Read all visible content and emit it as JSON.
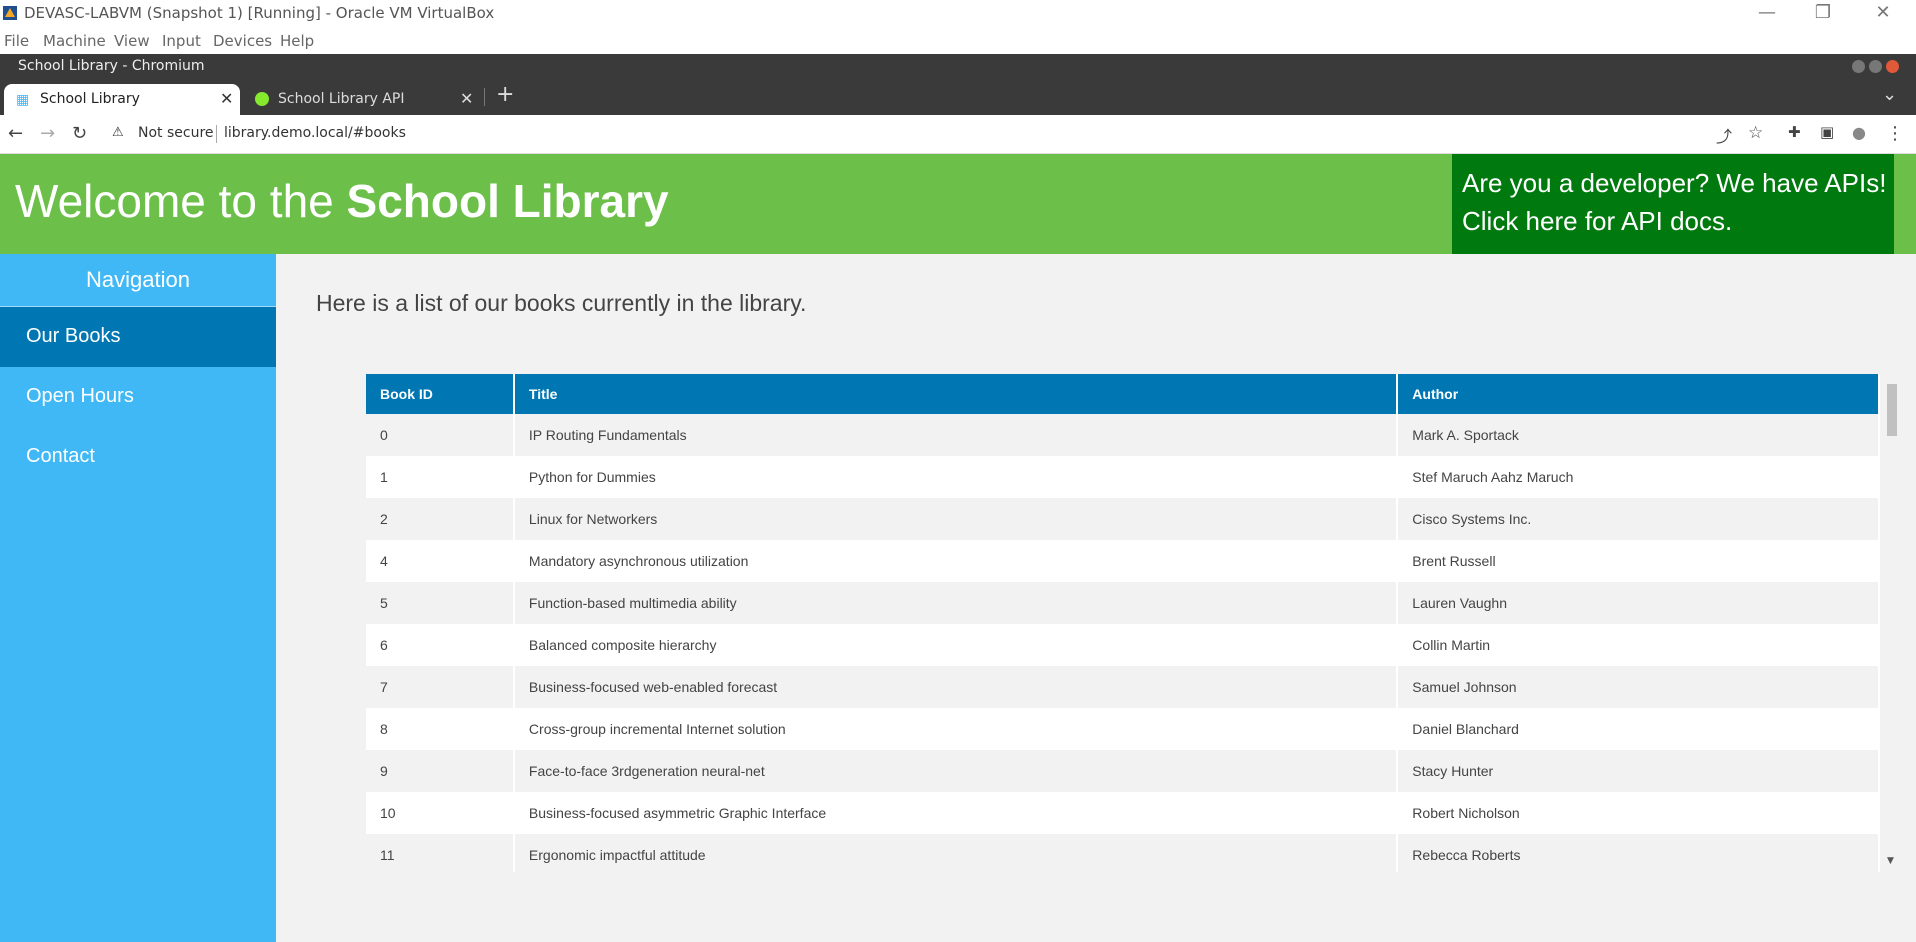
{
  "vbox": {
    "title": "DEVASC-LABVM (Snapshot 1) [Running] - Oracle VM VirtualBox",
    "menu": [
      "File",
      "Machine",
      "View",
      "Input",
      "Devices",
      "Help"
    ],
    "controls": {
      "minimize": "—",
      "restore": "❐",
      "close": "✕"
    }
  },
  "browser": {
    "window_title": "School Library - Chromium",
    "tabs": [
      {
        "label": "School Library",
        "active": true
      },
      {
        "label": "School Library API",
        "active": false
      }
    ],
    "tab_close": "✕",
    "new_tab": "+",
    "tab_menu": "⌄",
    "security": "Not secure",
    "url": "library.demo.local/#books",
    "icons": {
      "back": "←",
      "forward": "→",
      "reload": "↻",
      "warning": "⚠",
      "share": "⤴",
      "star": "☆",
      "extensions": "✚",
      "sidepanel": "▣",
      "profile": "●",
      "menu": "⋮"
    }
  },
  "page": {
    "banner_prefix": "Welcome to the ",
    "banner_bold": "School Library",
    "api_line1": "Are you a developer? We have APIs!",
    "api_line2": "Click here for API docs.",
    "nav_title": "Navigation",
    "nav_items": [
      {
        "label": "Our Books",
        "active": true
      },
      {
        "label": "Open Hours",
        "active": false
      },
      {
        "label": "Contact",
        "active": false
      }
    ],
    "intro": "Here is a list of our books currently in the library.",
    "table": {
      "headers": [
        "Book ID",
        "Title",
        "Author"
      ],
      "rows": [
        [
          "0",
          "IP Routing Fundamentals",
          "Mark A. Sportack"
        ],
        [
          "1",
          "Python for Dummies",
          "Stef Maruch Aahz Maruch"
        ],
        [
          "2",
          "Linux for Networkers",
          "Cisco Systems Inc."
        ],
        [
          "4",
          "Mandatory asynchronous utilization",
          "Brent Russell"
        ],
        [
          "5",
          "Function-based multimedia ability",
          "Lauren Vaughn"
        ],
        [
          "6",
          "Balanced composite hierarchy",
          "Collin Martin"
        ],
        [
          "7",
          "Business-focused web-enabled forecast",
          "Samuel Johnson"
        ],
        [
          "8",
          "Cross-group incremental Internet solution",
          "Daniel Blanchard"
        ],
        [
          "9",
          "Face-to-face 3rdgeneration neural-net",
          "Stacy Hunter"
        ],
        [
          "10",
          "Business-focused asymmetric Graphic Interface",
          "Robert Nicholson"
        ],
        [
          "11",
          "Ergonomic impactful attitude",
          "Rebecca Roberts"
        ]
      ]
    }
  },
  "colors": {
    "banner": "#6cc04a",
    "api_box": "#007a0f",
    "sidebar": "#3fb8f5",
    "nav_active": "#0077b3",
    "table_header": "#0077b3"
  }
}
